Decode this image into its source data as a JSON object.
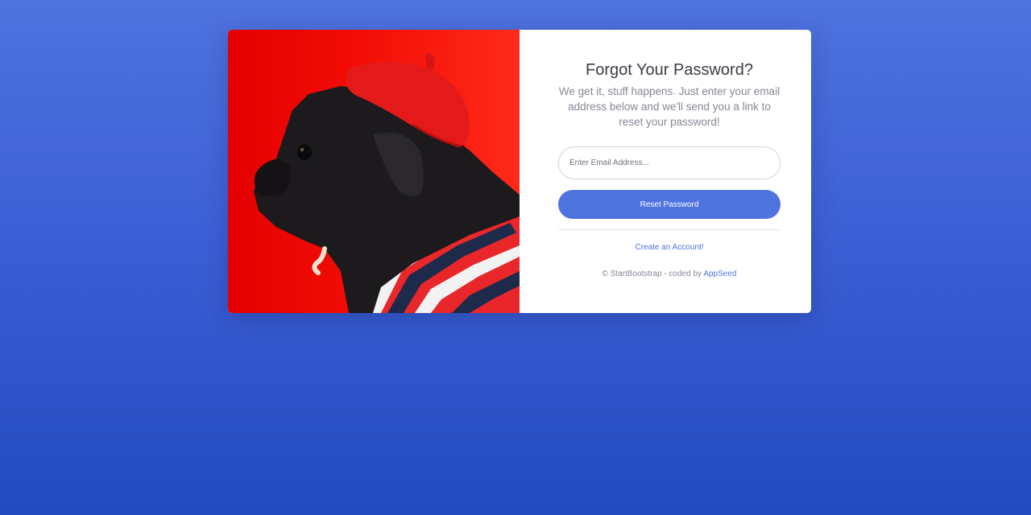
{
  "hero_image": {
    "alt": "pug wearing red beret and striped shirt"
  },
  "form": {
    "title": "Forgot Your Password?",
    "subtitle": "We get it, stuff happens. Just enter your email address below and we'll send you a link to reset your password!",
    "email_placeholder": "Enter Email Address...",
    "email_value": "",
    "submit_label": "Reset Password",
    "create_account_label": "Create an Account!"
  },
  "footer": {
    "prefix": "© StartBootstrap - coded by ",
    "link_label": "AppSeed"
  },
  "colors": {
    "accent": "#4e73df",
    "background_top": "#4e73df",
    "background_bottom": "#224abe",
    "image_red": "#e40000"
  }
}
